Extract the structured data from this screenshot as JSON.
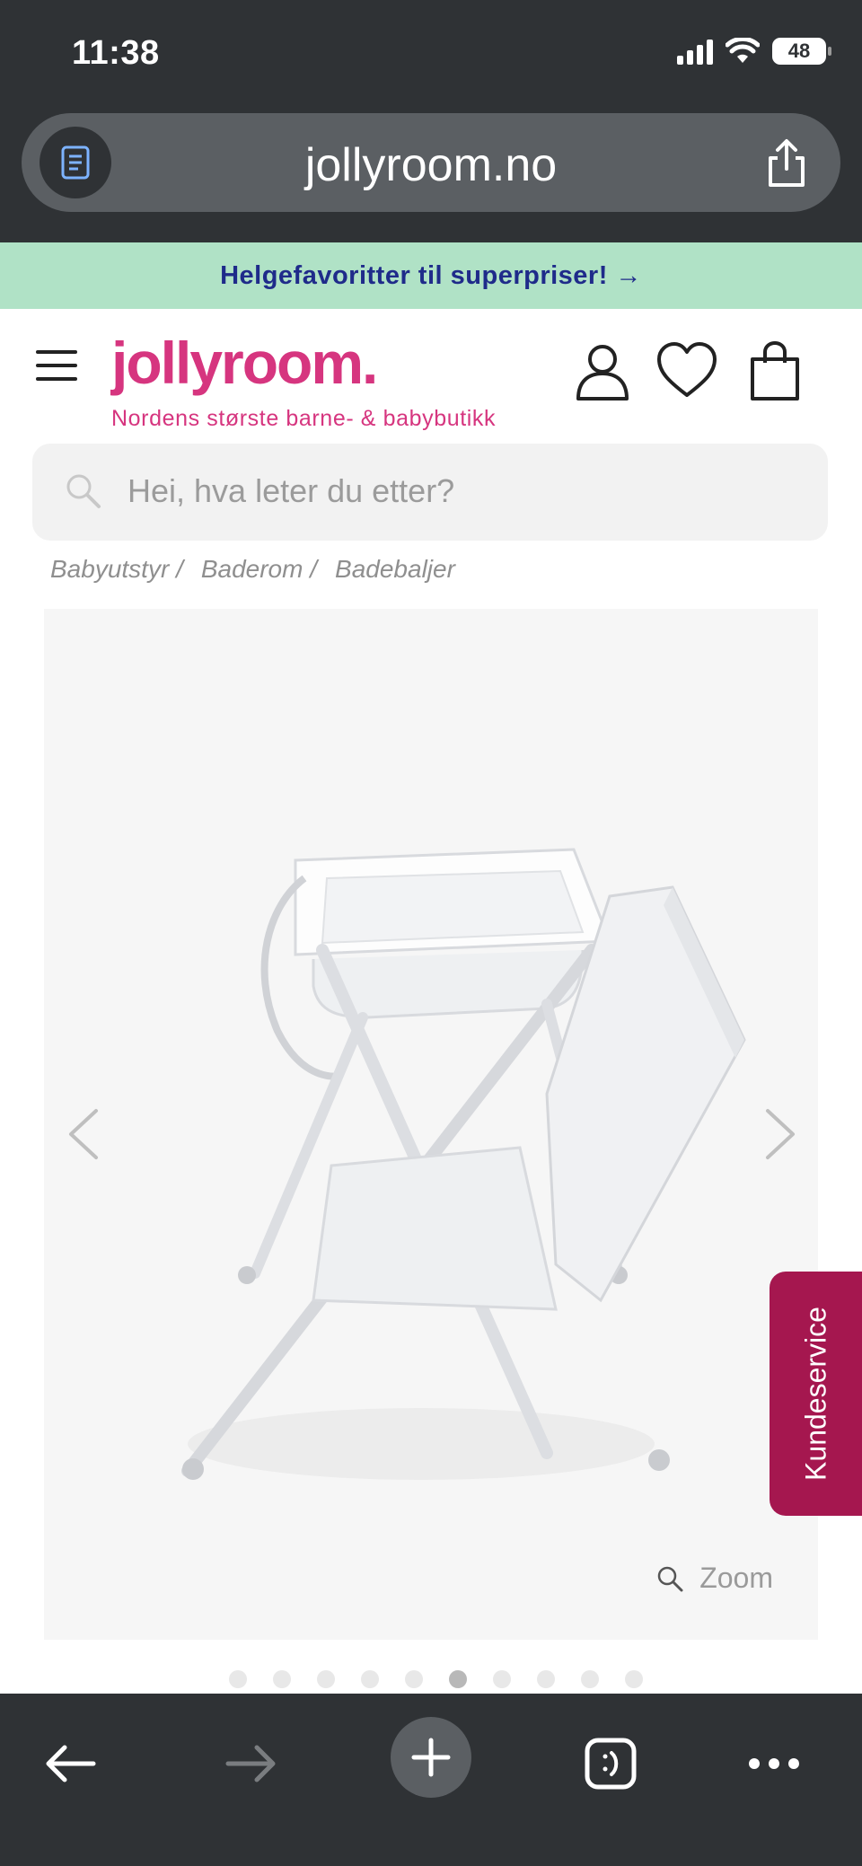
{
  "status_bar": {
    "time": "11:38",
    "battery": "48"
  },
  "browser": {
    "url": "jollyroom.no"
  },
  "promo": {
    "text": "Helgefavoritter til superpriser! →"
  },
  "header": {
    "logo": "jollyroom.",
    "tagline": "Nordens største barne- & babybutikk"
  },
  "search": {
    "placeholder": "Hei, hva leter du etter?"
  },
  "breadcrumb": [
    {
      "label": "Babyutstyr",
      "sep": "/"
    },
    {
      "label": "Baderom",
      "sep": "/"
    },
    {
      "label": "Badebaljer",
      "sep": ""
    }
  ],
  "gallery": {
    "zoom_label": "Zoom",
    "image_count": 10,
    "active_index": 5
  },
  "kundeservice": {
    "label": "Kundeservice"
  },
  "colors": {
    "brand_pink": "#d6357f",
    "kundeservice": "#a5174f",
    "promo_bg": "#b0e2c6",
    "promo_text": "#1f2b8a",
    "chrome": "#2f3235"
  },
  "icons": {
    "reader": "reader-icon",
    "share": "share-icon",
    "menu": "hamburger-icon",
    "account": "user-icon",
    "wishlist": "heart-icon",
    "cart": "shopping-bag-icon",
    "search": "search-icon",
    "zoom": "zoom-icon",
    "back": "back-arrow-icon",
    "forward": "forward-arrow-icon",
    "new_tab": "plus-icon",
    "tabs": "tabs-icon",
    "more": "more-icon"
  }
}
